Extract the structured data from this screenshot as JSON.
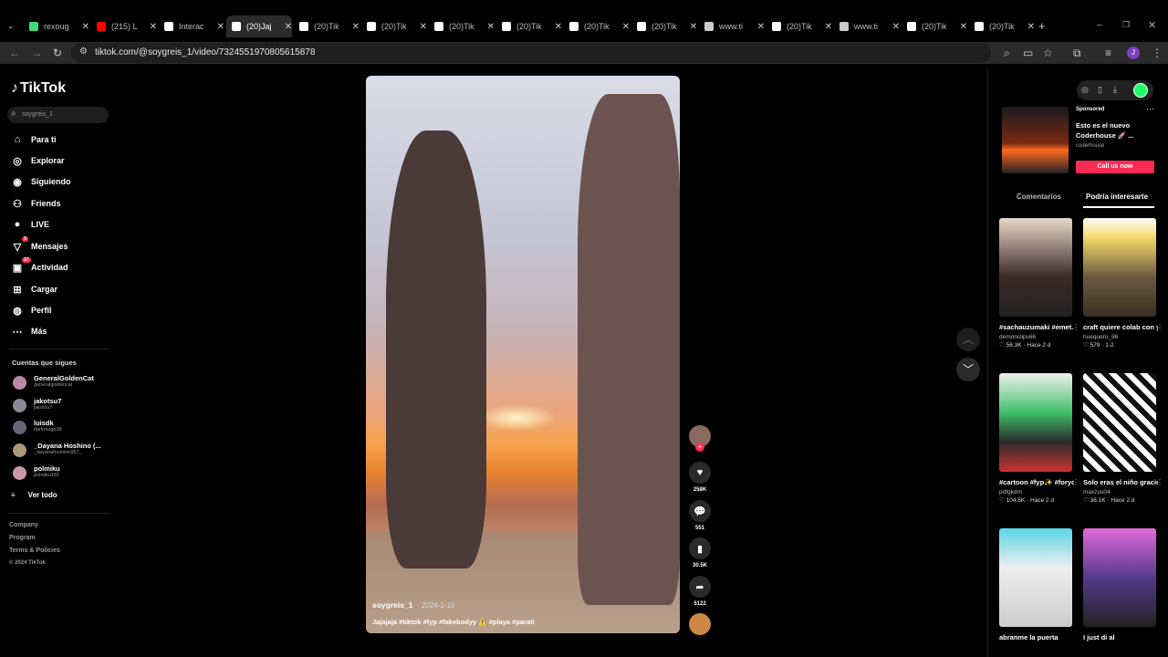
{
  "browser": {
    "tabs": [
      {
        "label": "rexoug",
        "color": "#3ddc84"
      },
      {
        "label": "(215) L",
        "color": "#ff0000"
      },
      {
        "label": "Interac",
        "color": "#ffffff"
      },
      {
        "label": "(20)Jaj",
        "color": "#ffffff"
      },
      {
        "label": "(20)Tik",
        "color": "#ffffff"
      },
      {
        "label": "(20)Tik",
        "color": "#ffffff"
      },
      {
        "label": "(20)Tik",
        "color": "#ffffff"
      },
      {
        "label": "(20)Tik",
        "color": "#ffffff"
      },
      {
        "label": "(20)Tik",
        "color": "#ffffff"
      },
      {
        "label": "(20)Tik",
        "color": "#ffffff"
      },
      {
        "label": "www.ti",
        "color": "#cccccc"
      },
      {
        "label": "(20)Tik",
        "color": "#ffffff"
      },
      {
        "label": "www.ti",
        "color": "#cccccc"
      },
      {
        "label": "(20)Tik",
        "color": "#ffffff"
      },
      {
        "label": "(20)Tik",
        "color": "#ffffff"
      }
    ],
    "url": "tiktok.com/@soygreis_1/video/7324551970805615878"
  },
  "sidebar": {
    "logo": "TikTok",
    "search_value": "soygreis_1",
    "nav": [
      {
        "label": "Para ti",
        "icon": "home-icon"
      },
      {
        "label": "Explorar",
        "icon": "compass-icon"
      },
      {
        "label": "Siguiendo",
        "icon": "following-icon"
      },
      {
        "label": "Friends",
        "icon": "friends-icon"
      },
      {
        "label": "LIVE",
        "icon": "live-icon"
      },
      {
        "label": "Mensajes",
        "icon": "messages-icon",
        "badge": "3"
      },
      {
        "label": "Actividad",
        "icon": "activity-icon",
        "badge": "17"
      },
      {
        "label": "Cargar",
        "icon": "upload-icon"
      },
      {
        "label": "Perfil",
        "icon": "profile-icon"
      },
      {
        "label": "Más",
        "icon": "more-icon"
      }
    ],
    "following_title": "Cuentas que sigues",
    "following": [
      {
        "name": "GeneralGoldenCat",
        "handle": "generalgoldencat"
      },
      {
        "name": "jakotsu7",
        "handle": "jakotsu7"
      },
      {
        "name": "luisdk",
        "handle": "darkmago38"
      },
      {
        "name": "_Dayana Hoshino (...",
        "handle": "_dayanahoshino957_"
      },
      {
        "name": "polmiku",
        "handle": "polmiku181"
      }
    ],
    "see_all": "Ver todo",
    "footer": [
      "Company",
      "Program",
      "Terms & Policies",
      "© 2024 TikTok"
    ]
  },
  "video": {
    "username": "soygreis_1",
    "date": "2024-1-15",
    "caption": "Jajajaja #tiktok #fyp #fakebodyy ⚠️ #playa #parati"
  },
  "actions": {
    "likes": "258K",
    "comments": "551",
    "saves": "30.5K",
    "shares": "5122"
  },
  "right": {
    "ad": {
      "sponsored": "Sponsored",
      "title": "Esto es el nuevo Coderhouse 🚀 ...",
      "brand": "coderhouse",
      "cta": "Call us now"
    },
    "tab_comments": "Comentarios",
    "tab_interest": "Podría interesarte",
    "cards": [
      {
        "title": "#sachauzumaki #emet...",
        "author": "demonclips66",
        "stats": "♡ 56.3K · Hace 2 d"
      },
      {
        "title": "craft quiere colab con yopos #clips...",
        "author": "huequero_96",
        "stats": "♡ 579 · 1-2"
      },
      {
        "title": "#cartoon #fyp✨ #foryou #edit...",
        "author": "pdfgkdm",
        "stats": "♡ 104.5K · Hace 2 d"
      },
      {
        "title": "Solo eras el niño gracioso con col...",
        "author": "maxzus04",
        "stats": "♡ 38.1K · Hace 2 d"
      },
      {
        "title": "abranme la puerta",
        "author": "",
        "stats": ""
      },
      {
        "title": "I just di al",
        "author": "",
        "stats": ""
      }
    ]
  }
}
